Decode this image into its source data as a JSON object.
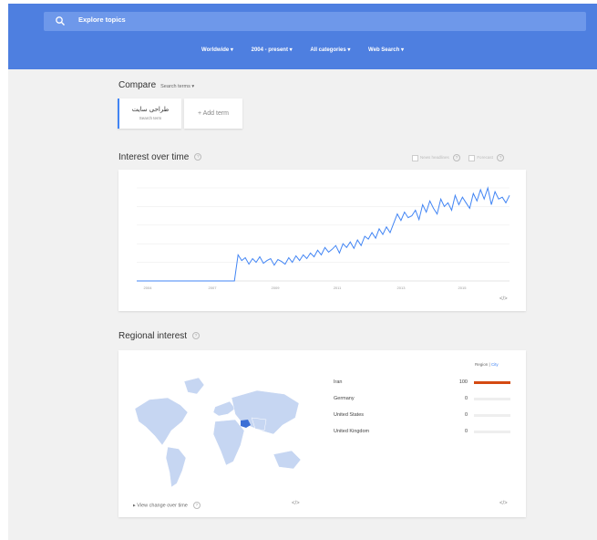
{
  "search": {
    "placeholder": "Explore topics",
    "icon": "search-icon"
  },
  "filters": [
    {
      "label": "Worldwide"
    },
    {
      "label": "2004 - present"
    },
    {
      "label": "All categories"
    },
    {
      "label": "Web Search"
    }
  ],
  "compare": {
    "title": "Compare",
    "dropdown": "Search terms"
  },
  "term": {
    "name": "طراحی سایت",
    "sub": "Search term"
  },
  "add_term": "+ Add term",
  "interest": {
    "title": "Interest over time",
    "opt_news": "News headlines",
    "opt_forecast": "Forecast",
    "embed": "</>"
  },
  "chart_data": {
    "type": "line",
    "title": "Interest over time",
    "xticks": [
      "2004",
      "2007",
      "2009",
      "2011",
      "2013",
      "2015"
    ],
    "ylim": [
      0,
      100
    ],
    "series": [
      {
        "values": [
          0,
          0,
          0,
          0,
          0,
          0,
          0,
          0,
          0,
          0,
          0,
          0,
          0,
          0,
          0,
          0,
          0,
          0,
          0,
          0,
          0,
          0,
          0,
          0,
          0,
          0,
          0,
          0,
          28,
          22,
          25,
          18,
          24,
          20,
          26,
          19,
          22,
          24,
          17,
          23,
          21,
          18,
          25,
          20,
          27,
          22,
          28,
          24,
          30,
          26,
          33,
          28,
          36,
          31,
          34,
          38,
          30,
          40,
          36,
          42,
          35,
          44,
          38,
          48,
          45,
          52,
          46,
          56,
          50,
          58,
          52,
          62,
          72,
          65,
          74,
          68,
          70,
          76,
          66,
          82,
          74,
          86,
          78,
          72,
          88,
          80,
          84,
          76,
          92,
          82,
          90,
          84,
          78,
          94,
          86,
          98,
          88,
          100,
          82,
          96,
          88,
          90,
          84,
          92
        ]
      }
    ]
  },
  "regional": {
    "title": "Regional interest",
    "region_label": "Region",
    "city_label": "City",
    "view_change": "View change over time",
    "embed_left": "</>",
    "embed_right": "</>",
    "rows": [
      {
        "name": "Iran",
        "value": "100",
        "frac": 1.0
      },
      {
        "name": "Germany",
        "value": "0",
        "frac": 0
      },
      {
        "name": "United States",
        "value": "0",
        "frac": 0
      },
      {
        "name": "United Kingdom",
        "value": "0",
        "frac": 0
      }
    ]
  },
  "colors": {
    "accent": "#4285f4",
    "topbar": "#4e7fe0",
    "map_land": "#c6d6f2",
    "map_highlight": "#3b6fd6",
    "bar": "#d44a12"
  }
}
